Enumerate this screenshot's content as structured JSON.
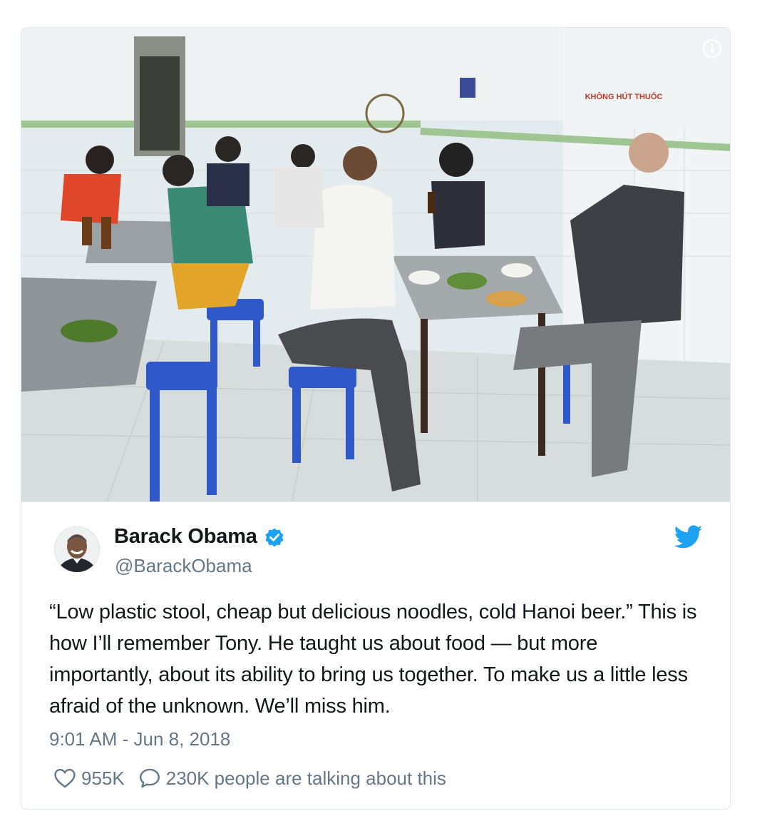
{
  "tweet": {
    "author_name": "Barack Obama",
    "author_handle": "@BarackObama",
    "text": "“Low plastic stool, cheap but delicious noodles, cold Hanoi beer.” This is how I’ll remember Tony. He taught us about food — but more importantly, about its ability to bring us together. To make us a little less afraid of the unknown. We’ll miss him.",
    "timestamp": "9:01 AM - Jun 8, 2018",
    "likes": "955K",
    "talking": "230K people are talking about this"
  },
  "photo": {
    "sign_text": "KHÔNG HÚT THUỐC"
  },
  "icons": {
    "info": "info-icon",
    "verified": "verified-badge-icon",
    "bird": "twitter-bird-icon",
    "like": "heart-icon",
    "reply": "speech-bubble-icon"
  },
  "colors": {
    "twitter_blue": "#1da1f2",
    "secondary_text": "#657786",
    "primary_text": "#14171a",
    "border": "#e1e8ed"
  }
}
